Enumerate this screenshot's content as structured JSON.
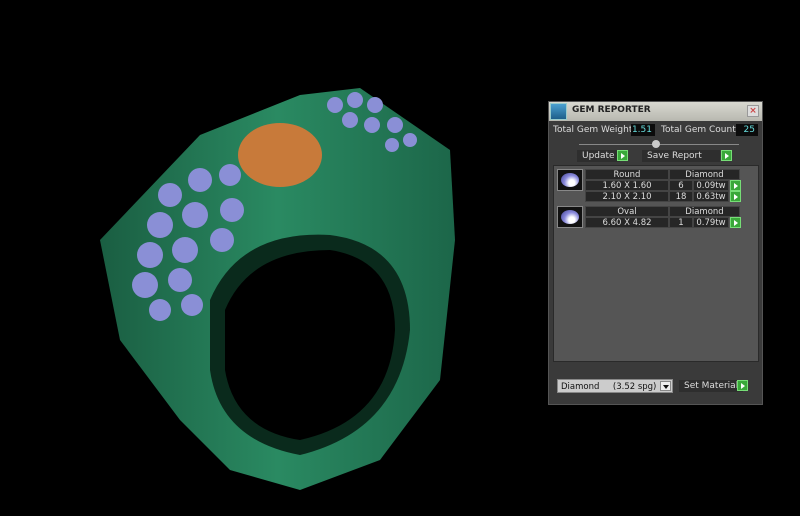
{
  "panel": {
    "title": "GEM REPORTER",
    "close_icon": "close-icon",
    "total_weight_label": "Total Gem Weight",
    "total_weight": "1.51",
    "total_count_label": "Total Gem Count",
    "total_count": "25",
    "update_label": "Update",
    "save_report_label": "Save Report",
    "groups": [
      {
        "shape": "Round",
        "material": "Diamond",
        "rows": [
          {
            "size": "1.60 X 1.60",
            "count": "6",
            "weight": "0.09tw"
          },
          {
            "size": "2.10 X 2.10",
            "count": "18",
            "weight": "0.63tw"
          }
        ]
      },
      {
        "shape": "Oval",
        "material": "Diamond",
        "rows": [
          {
            "size": "6.60 X 4.82",
            "count": "1",
            "weight": "0.79tw"
          }
        ]
      }
    ],
    "material_select": "Diamond     (3.52 spg)",
    "set_material_label": "Set Material"
  },
  "colors": {
    "metal": "#1f6b4c",
    "gem_blue": "#8a8fd6",
    "center_stone": "#c87a3a",
    "button_green": "#3aa83a"
  }
}
